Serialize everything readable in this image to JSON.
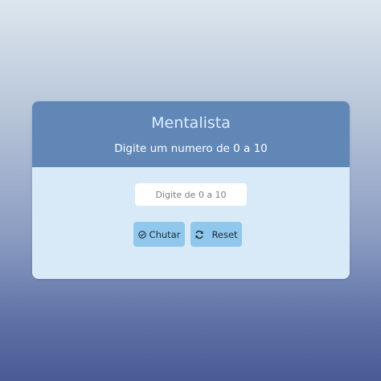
{
  "card": {
    "title": "Mentalista",
    "subtitle": "Digite um numero de 0 a 10"
  },
  "form": {
    "input_value": "",
    "input_placeholder": "Digite de 0 a 10",
    "guess_button_label": "Chutar",
    "guess_button_icon": "check-circle-icon",
    "reset_button_label": "Reset",
    "reset_button_icon": "refresh-icon"
  },
  "colors": {
    "header_bg": "#6187b7",
    "body_bg": "#d8eaf7",
    "button_bg": "#8fc8ec",
    "title_color": "#dbeeff"
  }
}
